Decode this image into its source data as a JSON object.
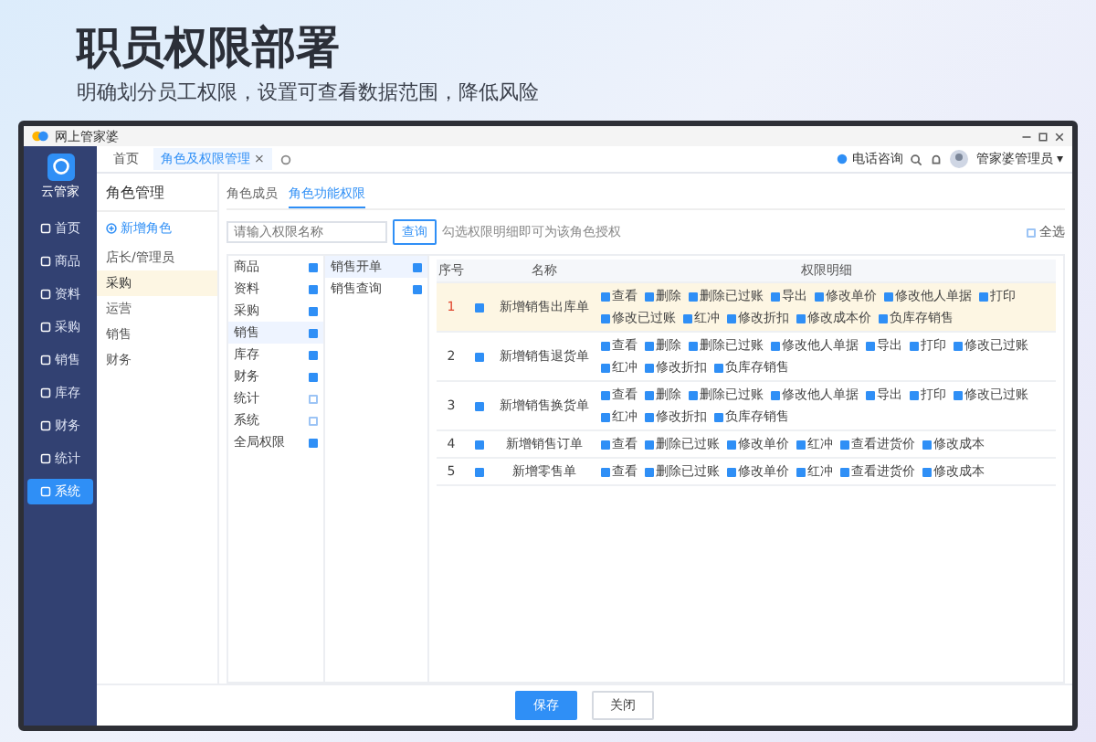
{
  "headline": "职员权限部署",
  "subheadline": "明确划分员工权限，设置可查看数据范围，降低风险",
  "window": {
    "title": "网上管家婆"
  },
  "brand": {
    "name": "云管家"
  },
  "nav": [
    {
      "label": "首页",
      "selected": false
    },
    {
      "label": "商品",
      "selected": false
    },
    {
      "label": "资料",
      "selected": false
    },
    {
      "label": "采购",
      "selected": false
    },
    {
      "label": "销售",
      "selected": false
    },
    {
      "label": "库存",
      "selected": false
    },
    {
      "label": "财务",
      "selected": false
    },
    {
      "label": "统计",
      "selected": false
    },
    {
      "label": "系统",
      "selected": true
    }
  ],
  "tabs": [
    {
      "label": "首页",
      "selected": false
    },
    {
      "label": "角色及权限管理",
      "selected": true,
      "close": "×"
    }
  ],
  "header": {
    "hotline": "电话咨询",
    "user": "管家婆管理员",
    "user_caret": "▾"
  },
  "role_panel": {
    "title": "角色管理",
    "add": "新增角色",
    "roles": [
      {
        "label": "店长/管理员",
        "selected": false
      },
      {
        "label": "采购",
        "selected": true
      },
      {
        "label": "运营",
        "selected": false
      },
      {
        "label": "销售",
        "selected": false
      },
      {
        "label": "财务",
        "selected": false
      }
    ]
  },
  "permission_tabs": [
    {
      "label": "角色成员",
      "selected": false
    },
    {
      "label": "角色功能权限",
      "selected": true
    }
  ],
  "search": {
    "placeholder": "请输入权限名称"
  },
  "search_button": "查询",
  "hint": "勾选权限明细即可为该角色授权",
  "select_all": {
    "label": "全选",
    "checked": false
  },
  "modules": [
    {
      "label": "商品",
      "checked": true,
      "selected": false
    },
    {
      "label": "资料",
      "checked": true,
      "selected": false
    },
    {
      "label": "采购",
      "checked": true,
      "selected": false
    },
    {
      "label": "销售",
      "checked": true,
      "selected": true
    },
    {
      "label": "库存",
      "checked": true,
      "selected": false
    },
    {
      "label": "财务",
      "checked": true,
      "selected": false
    },
    {
      "label": "统计",
      "checked": false,
      "selected": false
    },
    {
      "label": "系统",
      "checked": false,
      "selected": false
    },
    {
      "label": "全局权限",
      "checked": true,
      "selected": false
    }
  ],
  "submodules": [
    {
      "label": "销售开单",
      "checked": true,
      "selected": true
    },
    {
      "label": "销售查询",
      "checked": true,
      "selected": false
    }
  ],
  "table": {
    "columns": [
      "序号",
      "名称",
      "权限明细"
    ],
    "rows": [
      {
        "index": "1",
        "checked": true,
        "selected": true,
        "name": "新增销售出库单",
        "permissions": [
          {
            "label": "查看",
            "checked": true
          },
          {
            "label": "删除",
            "checked": true
          },
          {
            "label": "删除已过账",
            "checked": true
          },
          {
            "label": "导出",
            "checked": true
          },
          {
            "label": "修改单价",
            "checked": true
          },
          {
            "label": "修改他人单据",
            "checked": true
          },
          {
            "label": "打印",
            "checked": true
          },
          {
            "label": "修改已过账",
            "checked": true
          },
          {
            "label": "红冲",
            "checked": true
          },
          {
            "label": "修改折扣",
            "checked": true
          },
          {
            "label": "修改成本价",
            "checked": true
          },
          {
            "label": "负库存销售",
            "checked": true
          }
        ]
      },
      {
        "index": "2",
        "checked": true,
        "selected": false,
        "name": "新增销售退货单",
        "permissions": [
          {
            "label": "查看",
            "checked": true
          },
          {
            "label": "删除",
            "checked": true
          },
          {
            "label": "删除已过账",
            "checked": true
          },
          {
            "label": "修改他人单据",
            "checked": true
          },
          {
            "label": "导出",
            "checked": true
          },
          {
            "label": "打印",
            "checked": true
          },
          {
            "label": "修改已过账",
            "checked": true
          },
          {
            "label": "红冲",
            "checked": true
          },
          {
            "label": "修改折扣",
            "checked": true
          },
          {
            "label": "负库存销售",
            "checked": true
          }
        ]
      },
      {
        "index": "3",
        "checked": true,
        "selected": false,
        "name": "新增销售换货单",
        "permissions": [
          {
            "label": "查看",
            "checked": true
          },
          {
            "label": "删除",
            "checked": true
          },
          {
            "label": "删除已过账",
            "checked": true
          },
          {
            "label": "修改他人单据",
            "checked": true
          },
          {
            "label": "导出",
            "checked": true
          },
          {
            "label": "打印",
            "checked": true
          },
          {
            "label": "修改已过账",
            "checked": true
          },
          {
            "label": "红冲",
            "checked": true
          },
          {
            "label": "修改折扣",
            "checked": true
          },
          {
            "label": "负库存销售",
            "checked": true
          }
        ]
      },
      {
        "index": "4",
        "checked": true,
        "selected": false,
        "name": "新增销售订单",
        "permissions": [
          {
            "label": "查看",
            "checked": true
          },
          {
            "label": "删除已过账",
            "checked": true
          },
          {
            "label": "修改单价",
            "checked": true
          },
          {
            "label": "红冲",
            "checked": true
          },
          {
            "label": "查看进货价",
            "checked": true
          },
          {
            "label": "修改成本",
            "checked": true
          }
        ]
      },
      {
        "index": "5",
        "checked": true,
        "selected": false,
        "name": "新增零售单",
        "permissions": [
          {
            "label": "查看",
            "checked": true
          },
          {
            "label": "删除已过账",
            "checked": true
          },
          {
            "label": "修改单价",
            "checked": true
          },
          {
            "label": "红冲",
            "checked": true
          },
          {
            "label": "查看进货价",
            "checked": true
          },
          {
            "label": "修改成本",
            "checked": true
          }
        ]
      }
    ]
  },
  "buttons": [
    {
      "label": "保存",
      "kind": "primary"
    },
    {
      "label": "关闭",
      "kind": "secondary"
    }
  ]
}
